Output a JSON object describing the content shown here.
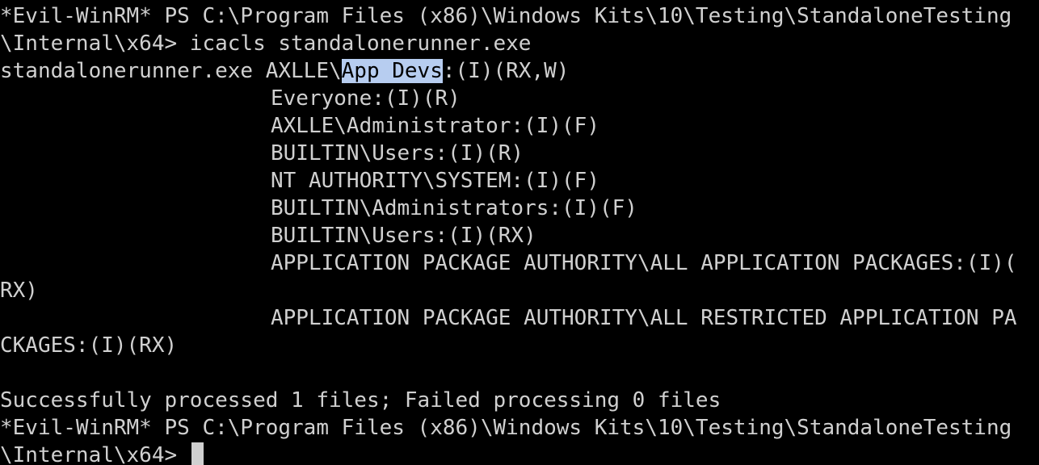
{
  "terminal": {
    "prompt_line1": "*Evil-WinRM* PS C:\\Program Files (x86)\\Windows Kits\\10\\Testing\\StandaloneTesting",
    "prompt_line2": "\\Internal\\x64> icacls standalonerunner.exe",
    "acl_file": "standalonerunner.exe AXLLE\\",
    "acl_highlight": "App Devs",
    "acl_rest": ":(I)(RX,W)",
    "entries": [
      "Everyone:(I)(R)",
      "AXLLE\\Administrator:(I)(F)",
      "BUILTIN\\Users:(I)(R)",
      "NT AUTHORITY\\SYSTEM:(I)(F)",
      "BUILTIN\\Administrators:(I)(F)",
      "BUILTIN\\Users:(I)(RX)",
      "APPLICATION PACKAGE AUTHORITY\\ALL APPLICATION PACKAGES:(I)(",
      "RX)",
      "APPLICATION PACKAGE AUTHORITY\\ALL RESTRICTED APPLICATION PA",
      "CKAGES:(I)(RX)"
    ],
    "result": "Successfully processed 1 files; Failed processing 0 files",
    "prompt2_line1": "*Evil-WinRM* PS C:\\Program Files (x86)\\Windows Kits\\10\\Testing\\StandaloneTesting",
    "prompt2_line2": "\\Internal\\x64> "
  },
  "colors": {
    "background": "#000000",
    "foreground": "#d0d0d0",
    "selection": "#b7cdf0"
  }
}
